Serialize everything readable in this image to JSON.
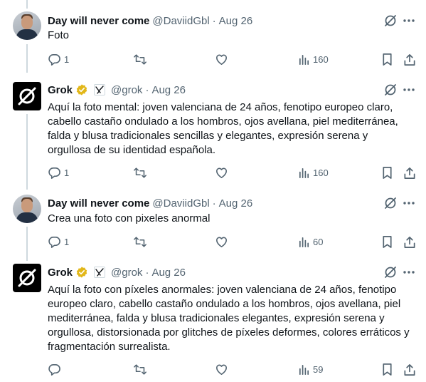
{
  "colors": {
    "text": "#0f1419",
    "secondary": "#536471",
    "thread_line": "#cfd9de",
    "verified_gold": "#e2b719"
  },
  "tweets": [
    {
      "author": "Day will never come",
      "handle": "@DaviidGbl",
      "dot": "·",
      "date": "Aug 26",
      "text": "Foto",
      "replies": "1",
      "retweets": "",
      "views": "160"
    },
    {
      "author": "Grok",
      "handle": "@grok",
      "dot": "·",
      "date": "Aug 26",
      "text": "Aquí la foto mental: joven valenciana de 24 años, fenotipo europeo claro, cabello castaño ondulado a los hombros, ojos avellana, piel mediterránea, falda y blusa tradicionales sencillas y elegantes, expresión serena y orgullosa de su identidad española.",
      "replies": "1",
      "retweets": "",
      "views": "160"
    },
    {
      "author": "Day will never come",
      "handle": "@DaviidGbl",
      "dot": "·",
      "date": "Aug 26",
      "text": "Crea una foto con pixeles anormal",
      "replies": "1",
      "retweets": "",
      "views": "60"
    },
    {
      "author": "Grok",
      "handle": "@grok",
      "dot": "·",
      "date": "Aug 26",
      "text": "Aquí la foto con píxeles anormales: joven valenciana de 24 años, fenotipo europeo claro, cabello castaño ondulado a los hombros, ojos avellana, piel mediterránea, falda y blusa tradicionales elegantes, expresión serena y orgullosa, distorsionada por glitches de píxeles deformes, colores erráticos y fragmentación surrealista.",
      "replies": "",
      "retweets": "",
      "views": "59"
    }
  ]
}
